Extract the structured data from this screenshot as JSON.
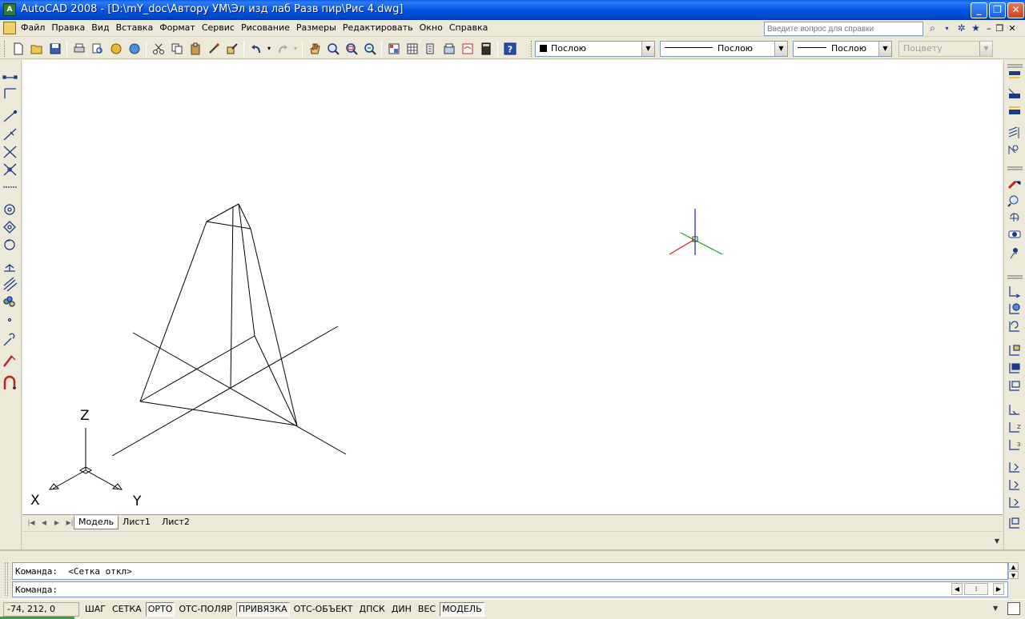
{
  "window": {
    "title": "AutoCAD 2008 - [D:\\mY_doc\\Автору УМ\\Эл изд лаб Разв пир\\Рис 4.dwg]",
    "app_icon_text": "A",
    "controls": [
      "_",
      "❐",
      "✕"
    ]
  },
  "menu": {
    "items": [
      "Файл",
      "Правка",
      "Вид",
      "Вставка",
      "Формат",
      "Сервис",
      "Рисование",
      "Размеры",
      "Редактировать",
      "Окно",
      "Справка"
    ],
    "help_placeholder": "Введите вопрос для справки",
    "mdi_controls": [
      "–",
      "❐",
      "✕"
    ]
  },
  "properties": {
    "color": "Послою",
    "linetype": "Послою",
    "lineweight": "Послою",
    "plotstyle": "Поцвету"
  },
  "drawing": {
    "ucs_labels": {
      "z": "Z",
      "x": "X",
      "y": "Y"
    },
    "colors": {
      "cursor_x": "#d01c1c",
      "cursor_y": "#1f9f1f",
      "cursor_z": "#0f1fcf",
      "lines": "#000000"
    }
  },
  "layout_tabs": {
    "tabs": [
      "Модель",
      "Лист1",
      "Лист2"
    ],
    "active": "Модель"
  },
  "command": {
    "history": "Команда:  <Сетка откл>",
    "prompt": "Команда:"
  },
  "status": {
    "coordinates": "-74, 212, 0",
    "buttons": [
      {
        "label": "ШАГ",
        "on": false
      },
      {
        "label": "СЕТКА",
        "on": false
      },
      {
        "label": "ОРТО",
        "on": true
      },
      {
        "label": "ОТС-ПОЛЯР",
        "on": false
      },
      {
        "label": "ПРИВЯЗКА",
        "on": true
      },
      {
        "label": "ОТС-ОБЪЕКТ",
        "on": false
      },
      {
        "label": "ДПСК",
        "on": false
      },
      {
        "label": "ДИН",
        "on": false
      },
      {
        "label": "ВЕС",
        "on": false
      },
      {
        "label": "МОДЕЛЬ",
        "on": true
      }
    ]
  }
}
